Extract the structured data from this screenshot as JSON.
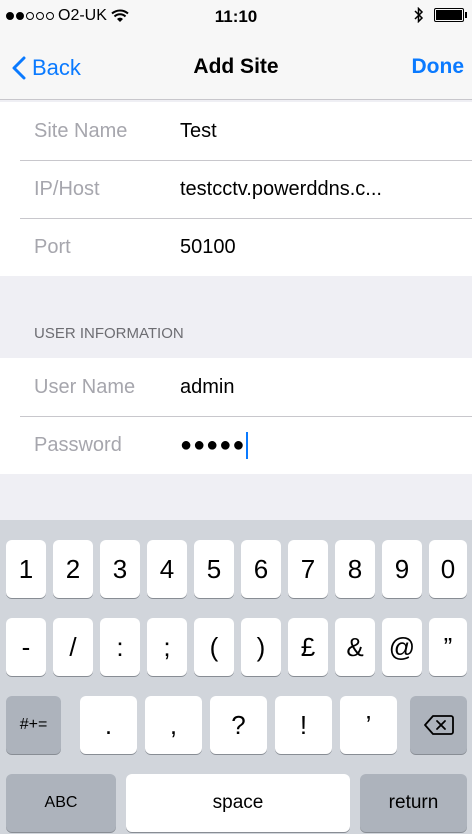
{
  "status": {
    "carrier": "O2-UK",
    "time": "11:10"
  },
  "nav": {
    "back": "Back",
    "title": "Add Site",
    "done": "Done"
  },
  "site": {
    "rows": [
      {
        "label": "Site Name",
        "value": "Test"
      },
      {
        "label": "IP/Host",
        "value": "testcctv.powerddns.c..."
      },
      {
        "label": "Port",
        "value": "50100"
      }
    ]
  },
  "user": {
    "section_title": "USER INFORMATION",
    "username_label": "User Name",
    "username_value": "admin",
    "password_label": "Password",
    "password_value": "●●●●●"
  },
  "keyboard": {
    "row1": [
      "1",
      "2",
      "3",
      "4",
      "5",
      "6",
      "7",
      "8",
      "9",
      "0"
    ],
    "row2": [
      "-",
      "/",
      ":",
      ";",
      "(",
      ")",
      "£",
      "&",
      "@",
      "”"
    ],
    "symbols_key": "#+=",
    "row3": [
      ".",
      ",",
      "?",
      "!",
      "’"
    ],
    "abc": "ABC",
    "space": "space",
    "return": "return"
  }
}
